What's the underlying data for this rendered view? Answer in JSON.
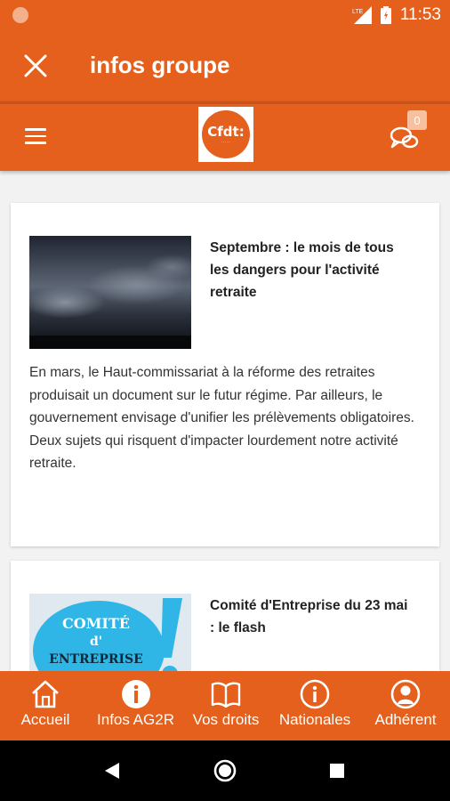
{
  "status_bar": {
    "time": "11:53",
    "network": "LTE",
    "icons": [
      "notification-dot-icon",
      "signal-icon",
      "battery-icon"
    ]
  },
  "app_bar": {
    "title": "infos groupe",
    "close_icon": "close-icon"
  },
  "sub_header": {
    "menu_icon": "hamburger-menu-icon",
    "logo_text": "Cfdt:",
    "chat_icon": "chat-bubbles-icon",
    "chat_count": "0"
  },
  "articles": [
    {
      "title": "Septembre : le mois de tous les dangers pour l'activité retraite",
      "body": "En mars, le Haut-commissariat à la réforme des retraites produisait un document sur le futur régime. Par ailleurs, le gouvernement envisage d'unifier les prélèvements obligatoires. Deux sujets qui risquent d'impacter lourdement notre activité retraite.",
      "image": "stormy-sky-image"
    },
    {
      "title": "Comité d'Entreprise du 23 mai : le flash",
      "image_text": [
        "COMITÉ",
        "d'",
        "ENTREPRISE"
      ],
      "image": "comite-entreprise-image"
    }
  ],
  "tabs": [
    {
      "label": "Accueil",
      "icon": "home-icon"
    },
    {
      "label": "Infos AG2R",
      "icon": "info-filled-icon"
    },
    {
      "label": "Vos droits",
      "icon": "book-icon"
    },
    {
      "label": "Nationales",
      "icon": "info-outline-icon"
    },
    {
      "label": "Adhérent",
      "icon": "user-icon"
    }
  ],
  "nav_bar": {
    "buttons": [
      "back-icon",
      "home-circle-icon",
      "recents-icon"
    ]
  },
  "colors": {
    "primary": "#e4601c",
    "background": "#f2f2f2",
    "card": "#ffffff",
    "nav_bar": "#000000"
  }
}
